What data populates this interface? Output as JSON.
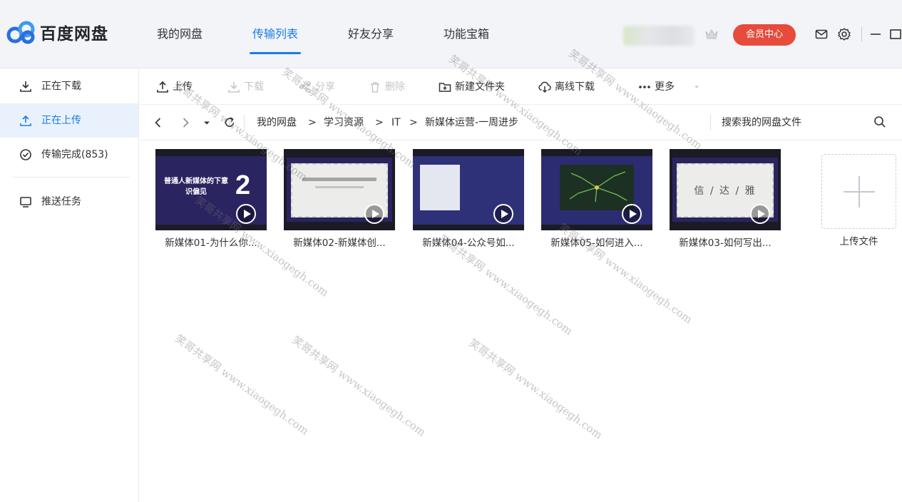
{
  "app": {
    "logo_text": "百度网盘"
  },
  "nav": {
    "tabs": [
      {
        "label": "我的网盘"
      },
      {
        "label": "传输列表"
      },
      {
        "label": "好友分享"
      },
      {
        "label": "功能宝箱"
      }
    ],
    "active_tab": "传输列表"
  },
  "header": {
    "vip_label": "会员中心"
  },
  "sidebar": {
    "items": [
      {
        "label": "正在下载",
        "icon": "download-icon"
      },
      {
        "label": "正在上传",
        "icon": "upload-icon"
      },
      {
        "label": "传输完成(853)",
        "icon": "check-circle-icon"
      },
      {
        "label": "推送任务",
        "icon": "monitor-icon"
      }
    ],
    "active_item": "正在上传"
  },
  "toolbar": {
    "upload": "上传",
    "download": "下载",
    "share": "分享",
    "delete": "删除",
    "new_folder": "新建文件夹",
    "offline_download": "离线下载",
    "more": "更多"
  },
  "address": {
    "crumbs": [
      "我的网盘",
      "学习资源",
      "IT",
      "新媒体运营-一周进步"
    ],
    "separator": ">",
    "search_placeholder": "搜索我的网盘文件"
  },
  "files": [
    {
      "name": "新媒体01-为什么你...",
      "thumb_text": "普通人新媒体的下意识偏见",
      "thumb_number": "2"
    },
    {
      "name": "新媒体02-新媒体创..."
    },
    {
      "name": "新媒体04-公众号如..."
    },
    {
      "name": "新媒体05-如何进入..."
    },
    {
      "name": "新媒体03-如何写出...",
      "thumb_text": "信 / 达 / 雅"
    }
  ],
  "upload_tile": {
    "label": "上传文件"
  },
  "watermark": {
    "text": "笑哥共享网 www.xiaogegh.com"
  },
  "colors": {
    "accent": "#1a7ce8",
    "vip": "#e64b3c",
    "sidebar_active_bg": "#e9f2fc"
  }
}
